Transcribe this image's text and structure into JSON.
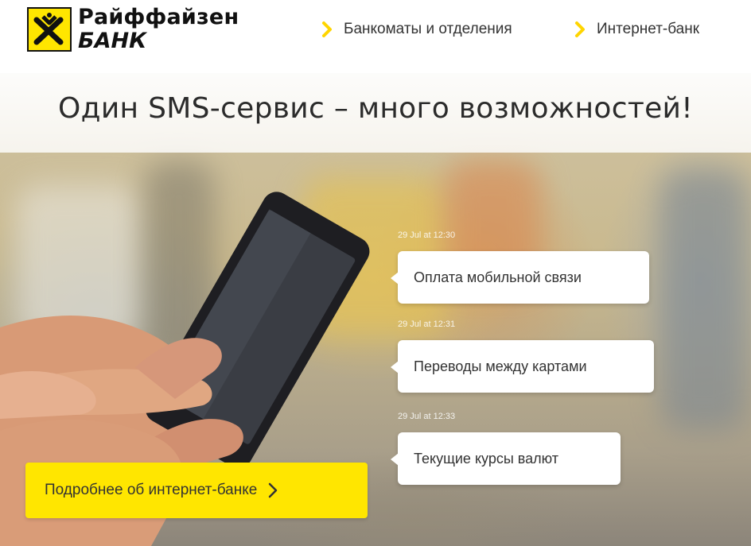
{
  "header": {
    "logo": {
      "line1": "Райффайзен",
      "line2": "БАНК"
    },
    "nav": [
      {
        "label": "Банкоматы и отделения",
        "icon": "chevron-right-icon"
      },
      {
        "label": "Интернет-банк",
        "icon": "chevron-right-icon"
      }
    ]
  },
  "hero": {
    "title": "Один SMS-сервис – много возможностей!",
    "messages": [
      {
        "time": "29 Jul at 12:30",
        "text": "Оплата мобильной связи"
      },
      {
        "time": "29 Jul at 12:31",
        "text": "Переводы между картами"
      },
      {
        "time": "29 Jul at 12:33",
        "text": "Текущие курсы валют"
      }
    ],
    "cta": {
      "label": "Подробнее об интернет-банке",
      "icon": "chevron-right-icon"
    }
  },
  "colors": {
    "brand_yellow": "#ffe600",
    "text_dark": "#333333"
  }
}
